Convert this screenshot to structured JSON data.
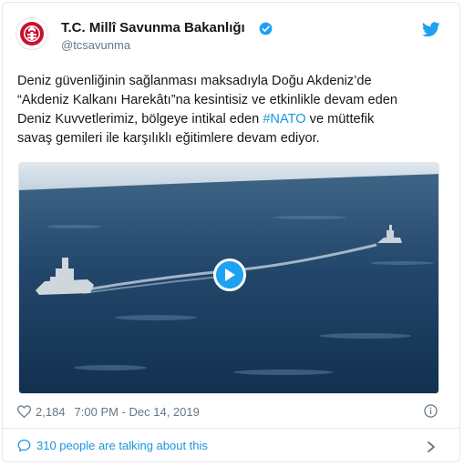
{
  "account": {
    "name": "T.C. Millî Savunma Bakanlığı",
    "handle": "@tcsavunma"
  },
  "tweet": {
    "lines": [
      "Deniz güvenliğinin sağlanması maksadıyla Doğu Akdeniz’de",
      "“Akdeniz Kalkanı Harekâtı”na kesintisiz ve etkinlikle devam eden",
      "Deniz Kuvvetlerimiz, bölgeye intikal eden ",
      "savaş gemileri ile karşılıklı eğitimlere devam ediyor."
    ],
    "hashtag": "#NATO",
    "line3_suffix": " ve müttefik"
  },
  "stats": {
    "likes": "2,184",
    "timestamp": "7:00 PM - Dec 14, 2019"
  },
  "conversation": {
    "label": "310 people are talking about this"
  },
  "colors": {
    "accent": "#1da1f2",
    "link": "#1b95e0",
    "text": "#14171a",
    "muted": "#657786",
    "logo_red": "#c8102e"
  },
  "icons": [
    "verified-badge-icon",
    "twitter-bird-icon",
    "play-icon",
    "heart-icon",
    "info-icon",
    "comment-bubble-icon",
    "chevron-right-icon"
  ]
}
